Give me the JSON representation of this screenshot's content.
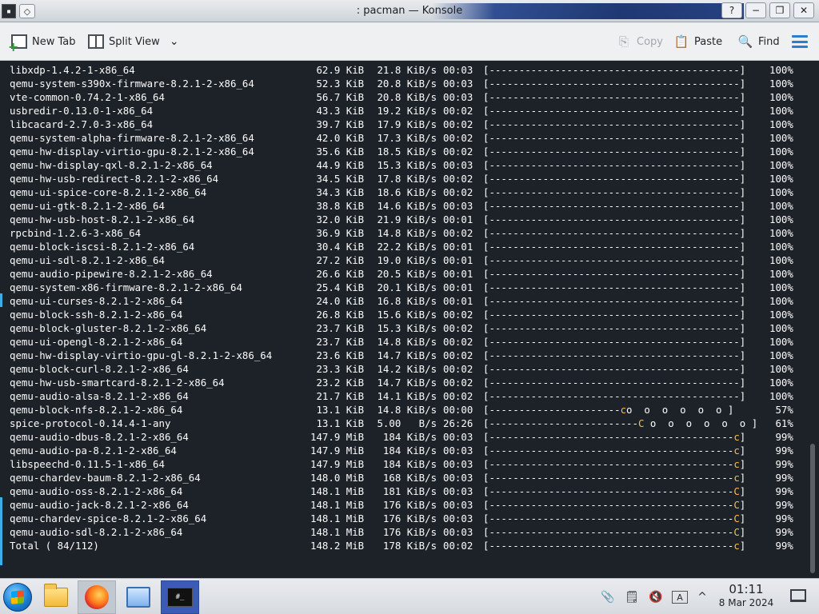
{
  "window": {
    "title": ": pacman — Konsole",
    "icon_text": "▪",
    "controls": [
      "?",
      "−",
      "❐",
      "✕"
    ]
  },
  "toolbar": {
    "new_tab_label": "New Tab",
    "split_view_label": "Split View",
    "split_view_chevron": "⌄",
    "copy_label": "Copy",
    "paste_label": "Paste",
    "find_label": "Find",
    "icons": {
      "new_tab": "new-tab-icon",
      "split_view": "split-view-icon",
      "copy": "copy-icon",
      "paste": "paste-icon",
      "find": "magnifier-icon",
      "menu": "hamburger-menu-icon"
    },
    "accent_color": "#2f7bd0"
  },
  "terminal": {
    "background": "#1d2228",
    "foreground": "#fcfcfc",
    "pacman_color": "#fdbc4b",
    "lines": [
      {
        "pkg": "libxdp-1.4.2-1-x86_64",
        "size": " 62.9 KiB",
        "rate": " 21.8 KiB/s",
        "eta": "00:03",
        "bar": "[------------------------------------------]",
        "pct": "100%"
      },
      {
        "pkg": "qemu-system-s390x-firmware-8.2.1-2-x86_64",
        "size": " 52.3 KiB",
        "rate": " 20.8 KiB/s",
        "eta": "00:03",
        "bar": "[------------------------------------------]",
        "pct": "100%"
      },
      {
        "pkg": "vte-common-0.74.2-1-x86_64",
        "size": " 56.7 KiB",
        "rate": " 20.8 KiB/s",
        "eta": "00:03",
        "bar": "[------------------------------------------]",
        "pct": "100%"
      },
      {
        "pkg": "usbredir-0.13.0-1-x86_64",
        "size": " 43.3 KiB",
        "rate": " 19.2 KiB/s",
        "eta": "00:02",
        "bar": "[------------------------------------------]",
        "pct": "100%"
      },
      {
        "pkg": "libcacard-2.7.0-3-x86_64",
        "size": " 39.7 KiB",
        "rate": " 17.9 KiB/s",
        "eta": "00:02",
        "bar": "[------------------------------------------]",
        "pct": "100%"
      },
      {
        "pkg": "qemu-system-alpha-firmware-8.2.1-2-x86_64",
        "size": " 42.0 KiB",
        "rate": " 17.3 KiB/s",
        "eta": "00:02",
        "bar": "[------------------------------------------]",
        "pct": "100%"
      },
      {
        "pkg": "qemu-hw-display-virtio-gpu-8.2.1-2-x86_64",
        "size": " 35.6 KiB",
        "rate": " 18.5 KiB/s",
        "eta": "00:02",
        "bar": "[------------------------------------------]",
        "pct": "100%"
      },
      {
        "pkg": "qemu-hw-display-qxl-8.2.1-2-x86_64",
        "size": " 44.9 KiB",
        "rate": " 15.3 KiB/s",
        "eta": "00:03",
        "bar": "[------------------------------------------]",
        "pct": "100%"
      },
      {
        "pkg": "qemu-hw-usb-redirect-8.2.1-2-x86_64",
        "size": " 34.5 KiB",
        "rate": " 17.8 KiB/s",
        "eta": "00:02",
        "bar": "[------------------------------------------]",
        "pct": "100%"
      },
      {
        "pkg": "qemu-ui-spice-core-8.2.1-2-x86_64",
        "size": " 34.3 KiB",
        "rate": " 18.6 KiB/s",
        "eta": "00:02",
        "bar": "[------------------------------------------]",
        "pct": "100%"
      },
      {
        "pkg": "qemu-ui-gtk-8.2.1-2-x86_64",
        "size": " 38.8 KiB",
        "rate": " 14.6 KiB/s",
        "eta": "00:03",
        "bar": "[------------------------------------------]",
        "pct": "100%"
      },
      {
        "pkg": "qemu-hw-usb-host-8.2.1-2-x86_64",
        "size": " 32.0 KiB",
        "rate": " 21.9 KiB/s",
        "eta": "00:01",
        "bar": "[------------------------------------------]",
        "pct": "100%"
      },
      {
        "pkg": "rpcbind-1.2.6-3-x86_64",
        "size": " 36.9 KiB",
        "rate": " 14.8 KiB/s",
        "eta": "00:02",
        "bar": "[------------------------------------------]",
        "pct": "100%"
      },
      {
        "pkg": "qemu-block-iscsi-8.2.1-2-x86_64",
        "size": " 30.4 KiB",
        "rate": " 22.2 KiB/s",
        "eta": "00:01",
        "bar": "[------------------------------------------]",
        "pct": "100%"
      },
      {
        "pkg": "qemu-ui-sdl-8.2.1-2-x86_64",
        "size": " 27.2 KiB",
        "rate": " 19.0 KiB/s",
        "eta": "00:01",
        "bar": "[------------------------------------------]",
        "pct": "100%"
      },
      {
        "pkg": "qemu-audio-pipewire-8.2.1-2-x86_64",
        "size": " 26.6 KiB",
        "rate": " 20.5 KiB/s",
        "eta": "00:01",
        "bar": "[------------------------------------------]",
        "pct": "100%"
      },
      {
        "pkg": "qemu-system-x86-firmware-8.2.1-2-x86_64",
        "size": " 25.4 KiB",
        "rate": " 20.1 KiB/s",
        "eta": "00:01",
        "bar": "[------------------------------------------]",
        "pct": "100%"
      },
      {
        "pkg": "qemu-ui-curses-8.2.1-2-x86_64",
        "size": " 24.0 KiB",
        "rate": " 16.8 KiB/s",
        "eta": "00:01",
        "bar": "[------------------------------------------]",
        "pct": "100%"
      },
      {
        "pkg": "qemu-block-ssh-8.2.1-2-x86_64",
        "size": " 26.8 KiB",
        "rate": " 15.6 KiB/s",
        "eta": "00:02",
        "bar": "[------------------------------------------]",
        "pct": "100%"
      },
      {
        "pkg": "qemu-block-gluster-8.2.1-2-x86_64",
        "size": " 23.7 KiB",
        "rate": " 15.3 KiB/s",
        "eta": "00:02",
        "bar": "[------------------------------------------]",
        "pct": "100%"
      },
      {
        "pkg": "qemu-ui-opengl-8.2.1-2-x86_64",
        "size": " 23.7 KiB",
        "rate": " 14.8 KiB/s",
        "eta": "00:02",
        "bar": "[------------------------------------------]",
        "pct": "100%"
      },
      {
        "pkg": "qemu-hw-display-virtio-gpu-gl-8.2.1-2-x86_64",
        "size": " 23.6 KiB",
        "rate": " 14.7 KiB/s",
        "eta": "00:02",
        "bar": "[------------------------------------------]",
        "pct": "100%"
      },
      {
        "pkg": "qemu-block-curl-8.2.1-2-x86_64",
        "size": " 23.3 KiB",
        "rate": " 14.2 KiB/s",
        "eta": "00:02",
        "bar": "[------------------------------------------]",
        "pct": "100%"
      },
      {
        "pkg": "qemu-hw-usb-smartcard-8.2.1-2-x86_64",
        "size": " 23.2 KiB",
        "rate": " 14.7 KiB/s",
        "eta": "00:02",
        "bar": "[------------------------------------------]",
        "pct": "100%"
      },
      {
        "pkg": "qemu-audio-alsa-8.2.1-2-x86_64",
        "size": " 21.7 KiB",
        "rate": " 14.1 KiB/s",
        "eta": "00:02",
        "bar": "[------------------------------------------]",
        "pct": "100%"
      },
      {
        "pkg": "qemu-block-nfs-8.2.1-2-x86_64",
        "size": " 13.1 KiB",
        "rate": " 14.8 KiB/s",
        "eta": "00:00",
        "bar_done": "[----------------------",
        "pac": "c",
        "bar_rest": "o  o  o  o  o  o ]",
        "pct": " 57%"
      },
      {
        "pkg": "spice-protocol-0.14.4-1-any",
        "size": " 13.1 KiB",
        "rate": " 5.00   B/s",
        "eta": "26:26",
        "bar_done": "[-------------------------",
        "pac": "C",
        "bar_rest": " o  o  o  o  o  o ]",
        "pct": " 61%"
      },
      {
        "pkg": "qemu-audio-dbus-8.2.1-2-x86_64",
        "size": "147.9 MiB",
        "rate": "  184 KiB/s",
        "eta": "00:03",
        "bar_done": "[-----------------------------------------",
        "pac": "c",
        "bar_rest": "]",
        "pct": " 99%"
      },
      {
        "pkg": "qemu-audio-pa-8.2.1-2-x86_64",
        "size": "147.9 MiB",
        "rate": "  184 KiB/s",
        "eta": "00:03",
        "bar_done": "[-----------------------------------------",
        "pac": "c",
        "bar_rest": "]",
        "pct": " 99%"
      },
      {
        "pkg": "libspeechd-0.11.5-1-x86_64",
        "size": "147.9 MiB",
        "rate": "  184 KiB/s",
        "eta": "00:03",
        "bar_done": "[-----------------------------------------",
        "pac": "c",
        "bar_rest": "]",
        "pct": " 99%"
      },
      {
        "pkg": "qemu-chardev-baum-8.2.1-2-x86_64",
        "size": "148.0 MiB",
        "rate": "  168 KiB/s",
        "eta": "00:03",
        "bar_done": "[-----------------------------------------",
        "pac": "c",
        "bar_rest": "]",
        "pct": " 99%"
      },
      {
        "pkg": "qemu-audio-oss-8.2.1-2-x86_64",
        "size": "148.1 MiB",
        "rate": "  181 KiB/s",
        "eta": "00:03",
        "bar_done": "[-----------------------------------------",
        "pac": "C",
        "bar_rest": "]",
        "pct": " 99%"
      },
      {
        "pkg": "qemu-audio-jack-8.2.1-2-x86_64",
        "size": "148.1 MiB",
        "rate": "  176 KiB/s",
        "eta": "00:03",
        "bar_done": "[-----------------------------------------",
        "pac": "C",
        "bar_rest": "]",
        "pct": " 99%"
      },
      {
        "pkg": "qemu-chardev-spice-8.2.1-2-x86_64",
        "size": "148.1 MiB",
        "rate": "  176 KiB/s",
        "eta": "00:03",
        "bar_done": "[-----------------------------------------",
        "pac": "C",
        "bar_rest": "]",
        "pct": " 99%"
      },
      {
        "pkg": "qemu-audio-sdl-8.2.1-2-x86_64",
        "size": "148.1 MiB",
        "rate": "  176 KiB/s",
        "eta": "00:03",
        "bar_done": "[-----------------------------------------",
        "pac": "C",
        "bar_rest": "]",
        "pct": " 99%"
      },
      {
        "pkg": "Total ( 84/112)",
        "size": "148.2 MiB",
        "rate": "  178 KiB/s",
        "eta": "00:02",
        "bar_done": "[-----------------------------------------",
        "pac": "c",
        "bar_rest": "]",
        "pct": " 99%"
      }
    ]
  },
  "taskbar": {
    "start_icon": "windows-start-orb-icon",
    "tasks": [
      {
        "name": "file-manager-task",
        "icon": "folder-icon"
      },
      {
        "name": "firefox-task",
        "icon": "firefox-icon"
      },
      {
        "name": "network-task",
        "icon": "network-icon"
      },
      {
        "name": "konsole-task",
        "icon": "konsole-icon",
        "icon_text": "#_"
      }
    ],
    "tray": {
      "clipboard_icon": "clipboard-icon",
      "notes_icon": "notes-icon",
      "volume_icon": "volume-muted-icon",
      "input_icon": "input-method-icon",
      "input_text": "A",
      "expand_icon": "chevron-up-icon",
      "expand_text": "^"
    },
    "clock": {
      "time": "01:11",
      "date": "8 Mar 2024"
    },
    "show_desktop_icon": "show-desktop-icon"
  }
}
